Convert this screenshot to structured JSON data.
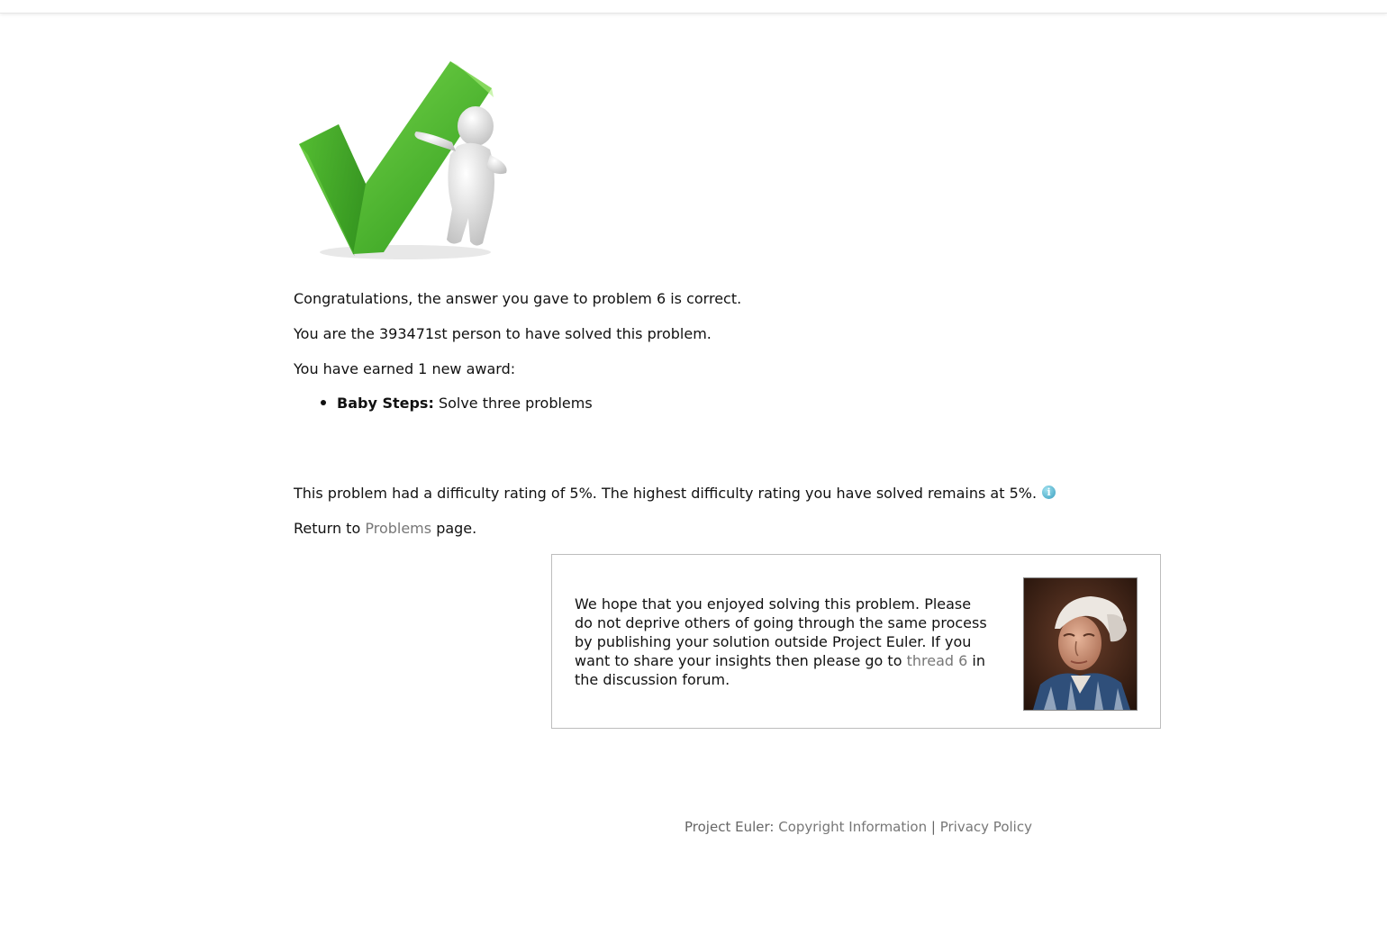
{
  "messages": {
    "correct": "Congratulations, the answer you gave to problem 6 is correct.",
    "rank": "You are the 393471st person to have solved this problem.",
    "awards_intro": "You have earned 1 new award:"
  },
  "award": {
    "name": "Baby Steps:",
    "description": "Solve three problems"
  },
  "difficulty": {
    "text": "This problem had a difficulty rating of 5%. The highest difficulty rating you have solved remains at 5%."
  },
  "return_line": {
    "prefix": "Return to",
    "link": "Problems",
    "suffix": "page."
  },
  "forum_box": {
    "text_before": "We hope that you enjoyed solving this problem. Please do not deprive others of going through the same process by publishing your solution outside Project Euler. If you want to share your insights then please go to",
    "thread_link": "thread 6",
    "text_after": "in the discussion forum."
  },
  "footer": {
    "prefix": "Project Euler:",
    "copyright": "Copyright Information",
    "separator": "|",
    "privacy": "Privacy Policy"
  },
  "icons": {
    "hero": "checkmark-with-figure-icon",
    "info": "info-icon",
    "portrait": "euler-portrait"
  },
  "colors": {
    "check_green": "#4fbf2e",
    "link_gray": "#777777",
    "info_blue": "#3a9fc0"
  }
}
